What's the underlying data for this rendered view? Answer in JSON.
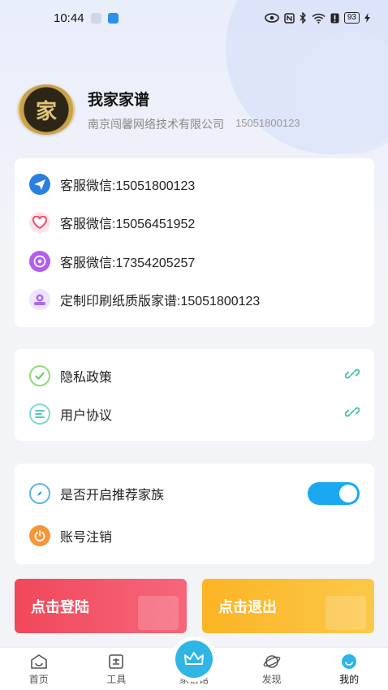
{
  "status_bar": {
    "time": "10:44",
    "battery": "93"
  },
  "profile": {
    "avatar_char": "家",
    "name": "我家家谱",
    "company": "南京闯馨网络技术有限公司",
    "phone": "15051800123"
  },
  "contacts": [
    {
      "label": "客服微信:15051800123",
      "icon": "paper-plane-icon",
      "color": "#2a7fe0"
    },
    {
      "label": "客服微信:15056451952",
      "icon": "heart-icon",
      "color": "#f04d6a"
    },
    {
      "label": "客服微信:17354205257",
      "icon": "ball-icon",
      "color": "#b45cf0"
    },
    {
      "label": "定制印刷纸质版家谱:15051800123",
      "icon": "print-icon",
      "color": "#a46bf0"
    }
  ],
  "policies": [
    {
      "label": "隐私政策",
      "icon": "shield-check-icon",
      "color": "#5cc95a"
    },
    {
      "label": "用户协议",
      "icon": "document-lines-icon",
      "color": "#3cc0c0"
    }
  ],
  "settings": {
    "recommend_label": "是否开启推荐家族",
    "recommend_enabled": true,
    "recommend_icon": "compass-icon",
    "cancel_label": "账号注销",
    "cancel_icon": "power-icon"
  },
  "actions": {
    "login_label": "点击登陆",
    "logout_label": "点击退出",
    "login_color": "#f24e62",
    "logout_color": "#fbbf2b"
  },
  "nav": [
    {
      "label": "首页",
      "icon": "home-icon"
    },
    {
      "label": "工具",
      "icon": "toolbox-icon"
    },
    {
      "label": "家谱馆",
      "icon": "crown-icon"
    },
    {
      "label": "发现",
      "icon": "planet-icon"
    },
    {
      "label": "我的",
      "icon": "smile-icon",
      "active": true
    }
  ],
  "colors": {
    "accent": "#1ba8f0",
    "link_icon": "#3cc0a8"
  }
}
